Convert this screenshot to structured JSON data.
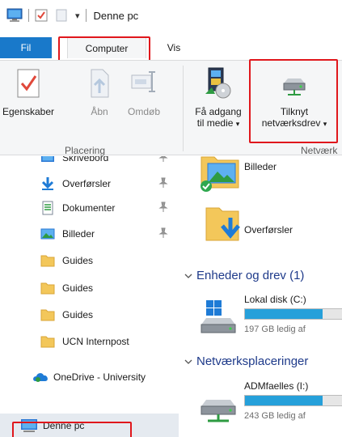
{
  "title_bar": {
    "title": "Denne pc",
    "quick_access_dropdown": "▾"
  },
  "ribbon_tabs": [
    {
      "label": "Fil"
    },
    {
      "label": "Computer"
    },
    {
      "label": "Vis"
    }
  ],
  "ribbon": {
    "placering": {
      "group_label": "Placering",
      "items": [
        {
          "label": "Egenskaber",
          "icon": "properties-checkmark-icon",
          "enabled": true
        },
        {
          "label": "Åbn",
          "icon": "open-file-icon",
          "enabled": false
        },
        {
          "label": "Omdøb",
          "icon": "rename-icon",
          "enabled": false
        }
      ]
    },
    "netvaerk": {
      "group_label": "Netværk",
      "items": [
        {
          "label_line1": "Få adgang",
          "label_line2": "til medie",
          "icon": "media-access-icon"
        },
        {
          "label_line1": "Tilknyt",
          "label_line2": "netværksdrev",
          "icon": "network-drive-icon"
        }
      ]
    },
    "dropdown_arrow": "▾"
  },
  "nav_pane": {
    "items": [
      {
        "label": "Skrivebord",
        "icon": "desktop-folder-icon",
        "pinned": true
      },
      {
        "label": "Overførsler",
        "icon": "download-arrow-icon",
        "pinned": true
      },
      {
        "label": "Dokumenter",
        "icon": "documents-icon",
        "pinned": true
      },
      {
        "label": "Billeder",
        "icon": "pictures-icon",
        "pinned": true
      },
      {
        "label": "Guides",
        "icon": "folder-icon",
        "pinned": false
      },
      {
        "label": "Guides",
        "icon": "folder-icon",
        "pinned": false
      },
      {
        "label": "Guides",
        "icon": "folder-icon",
        "pinned": false
      },
      {
        "label": "UCN Internpost",
        "icon": "folder-icon",
        "pinned": false
      },
      {
        "label": "OneDrive - University",
        "icon": "onedrive-cloud-icon",
        "pinned": false
      },
      {
        "label": "Denne pc",
        "icon": "this-pc-icon",
        "pinned": false,
        "selected": true
      }
    ]
  },
  "content": {
    "folders": [
      {
        "label": "Billeder",
        "icon": "pictures-folder-icon"
      },
      {
        "label": "Overførsler",
        "icon": "downloads-folder-icon"
      }
    ],
    "devices_group": {
      "header": "Enheder og drev (1)",
      "drives": [
        {
          "label": "Lokal disk (C:)",
          "free_text": "197 GB ledig af",
          "used_fraction": 0.75,
          "icon": "windows-drive-icon"
        }
      ]
    },
    "network_group": {
      "header": "Netværksplaceringer",
      "drives": [
        {
          "label": "ADMfaelles (I:)",
          "free_text": "243 GB ledig af",
          "used_fraction": 0.75,
          "icon": "network-share-drive-icon"
        }
      ]
    }
  }
}
